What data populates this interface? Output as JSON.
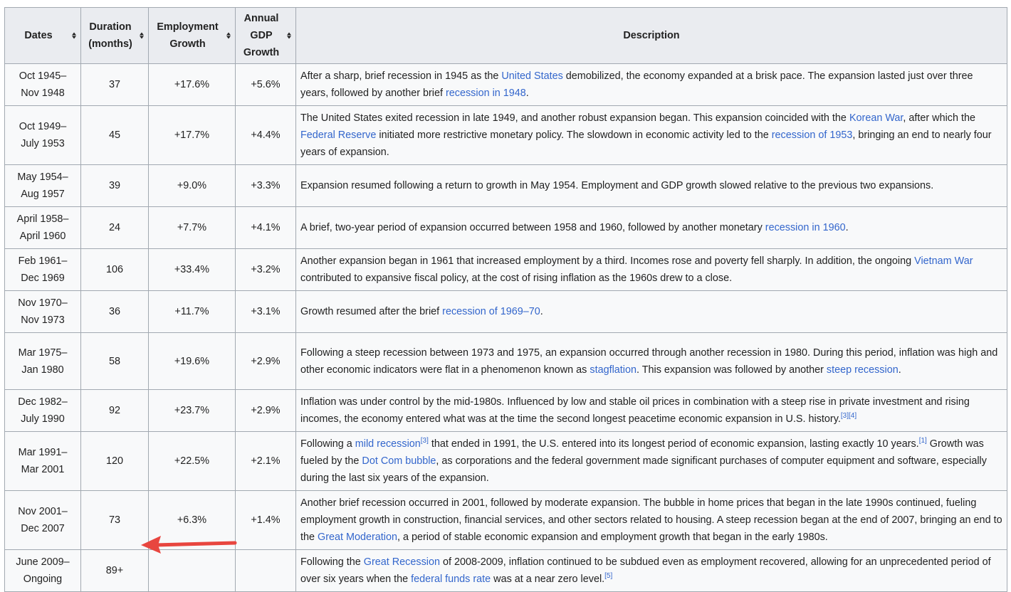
{
  "headers": {
    "dates": "Dates",
    "duration": [
      "Duration",
      "(months)"
    ],
    "employment": [
      "Employment",
      "Growth"
    ],
    "gdp": [
      "Annual",
      "GDP",
      "Growth"
    ],
    "description": "Description"
  },
  "rows": [
    {
      "dates": [
        "Oct 1945–",
        "Nov 1948"
      ],
      "duration": "37",
      "employment": "+17.6%",
      "gdp": "+5.6%",
      "desc": [
        {
          "t": "After a sharp, brief recession in 1945 as the "
        },
        {
          "l": "United States"
        },
        {
          "t": " demobilized, the economy expanded at a brisk pace. The expansion lasted just over three years, followed by another brief "
        },
        {
          "l": "recession in 1948"
        },
        {
          "t": "."
        }
      ]
    },
    {
      "dates": [
        "Oct 1949–",
        "July 1953"
      ],
      "duration": "45",
      "employment": "+17.7%",
      "gdp": "+4.4%",
      "desc": [
        {
          "t": "The United States exited recession in late 1949, and another robust expansion began. This expansion coincided with the "
        },
        {
          "l": "Korean War"
        },
        {
          "t": ", after which the "
        },
        {
          "l": "Federal Reserve"
        },
        {
          "t": " initiated more restrictive monetary policy. The slowdown in economic activity led to the "
        },
        {
          "l": "recession of 1953"
        },
        {
          "t": ", bringing an end to nearly four years of expansion."
        }
      ]
    },
    {
      "dates": [
        "May 1954–",
        "Aug 1957"
      ],
      "duration": "39",
      "employment": "+9.0%",
      "gdp": "+3.3%",
      "desc": [
        {
          "t": "Expansion resumed following a return to growth in May 1954. Employment and GDP growth slowed relative to the previous two expansions."
        }
      ]
    },
    {
      "dates": [
        "April 1958–",
        "April 1960"
      ],
      "duration": "24",
      "employment": "+7.7%",
      "gdp": "+4.1%",
      "desc": [
        {
          "t": "A brief, two-year period of expansion occurred between 1958 and 1960, followed by another monetary "
        },
        {
          "l": "recession in 1960"
        },
        {
          "t": "."
        }
      ]
    },
    {
      "dates": [
        "Feb 1961–",
        "Dec 1969"
      ],
      "duration": "106",
      "employment": "+33.4%",
      "gdp": "+3.2%",
      "desc": [
        {
          "t": "Another expansion began in 1961 that increased employment by a third. Incomes rose and poverty fell sharply. In addition, the ongoing "
        },
        {
          "l": "Vietnam War"
        },
        {
          "t": " contributed to expansive fiscal policy, at the cost of rising inflation as the 1960s drew to a close."
        }
      ]
    },
    {
      "dates": [
        "Nov 1970–",
        "Nov 1973"
      ],
      "duration": "36",
      "employment": "+11.7%",
      "gdp": "+3.1%",
      "desc": [
        {
          "t": "Growth resumed after the brief "
        },
        {
          "l": "recession of 1969–70"
        },
        {
          "t": "."
        }
      ]
    },
    {
      "dates": [
        "Mar 1975–",
        "Jan 1980"
      ],
      "duration": "58",
      "employment": "+19.6%",
      "gdp": "+2.9%",
      "desc": [
        {
          "t": "Following a steep recession between 1973 and 1975, an expansion occurred through another recession in 1980. During this period, inflation was high and other economic indicators were flat in a phenomenon known as "
        },
        {
          "l": "stagflation"
        },
        {
          "t": ". This expansion was followed by another "
        },
        {
          "l": "steep recession"
        },
        {
          "t": "."
        }
      ]
    },
    {
      "dates": [
        "Dec 1982–",
        "July 1990"
      ],
      "duration": "92",
      "employment": "+23.7%",
      "gdp": "+2.9%",
      "desc": [
        {
          "t": "Inflation was under control by the mid-1980s. Influenced by low and stable oil prices in combination with a steep rise in private investment and rising incomes, the economy entered what was at the time the second longest peacetime economic expansion in U.S. history."
        },
        {
          "s": "[3]"
        },
        {
          "s": "[4]"
        }
      ]
    },
    {
      "dates": [
        "Mar 1991–",
        "Mar 2001"
      ],
      "duration": "120",
      "employment": "+22.5%",
      "gdp": "+2.1%",
      "desc": [
        {
          "t": "Following a "
        },
        {
          "l": "mild recession"
        },
        {
          "s": "[3]"
        },
        {
          "t": " that ended in 1991, the U.S. entered into its longest period of economic expansion, lasting exactly 10 years."
        },
        {
          "s": "[1]"
        },
        {
          "t": " Growth was fueled by the "
        },
        {
          "l": "Dot Com bubble"
        },
        {
          "t": ", as corporations and the federal government made significant purchases of computer equipment and software, especially during the last six years of the expansion."
        }
      ]
    },
    {
      "dates": [
        "Nov 2001–",
        "Dec 2007"
      ],
      "duration": "73",
      "employment": "+6.3%",
      "gdp": "+1.4%",
      "desc": [
        {
          "t": "Another brief recession occurred in 2001, followed by moderate expansion. The bubble in home prices that began in the late 1990s continued, fueling employment growth in construction, financial services, and other sectors related to housing. A steep recession began at the end of 2007, bringing an end to the "
        },
        {
          "l": "Great Moderation"
        },
        {
          "t": ", a period of stable economic expansion and employment growth that began in the early 1980s."
        }
      ]
    },
    {
      "dates": [
        "June 2009–",
        "Ongoing"
      ],
      "duration": "89+",
      "employment": "",
      "gdp": "",
      "desc": [
        {
          "t": "Following the "
        },
        {
          "l": "Great Recession"
        },
        {
          "t": " of 2008-2009, inflation continued to be subdued even as employment recovered, allowing for an unprecedented period of over six years when the "
        },
        {
          "l": "federal funds rate"
        },
        {
          "t": " was at a near zero level."
        },
        {
          "s": "[5]"
        }
      ]
    }
  ],
  "arrow": {
    "color": "#e8463f",
    "points_to": "89+"
  }
}
